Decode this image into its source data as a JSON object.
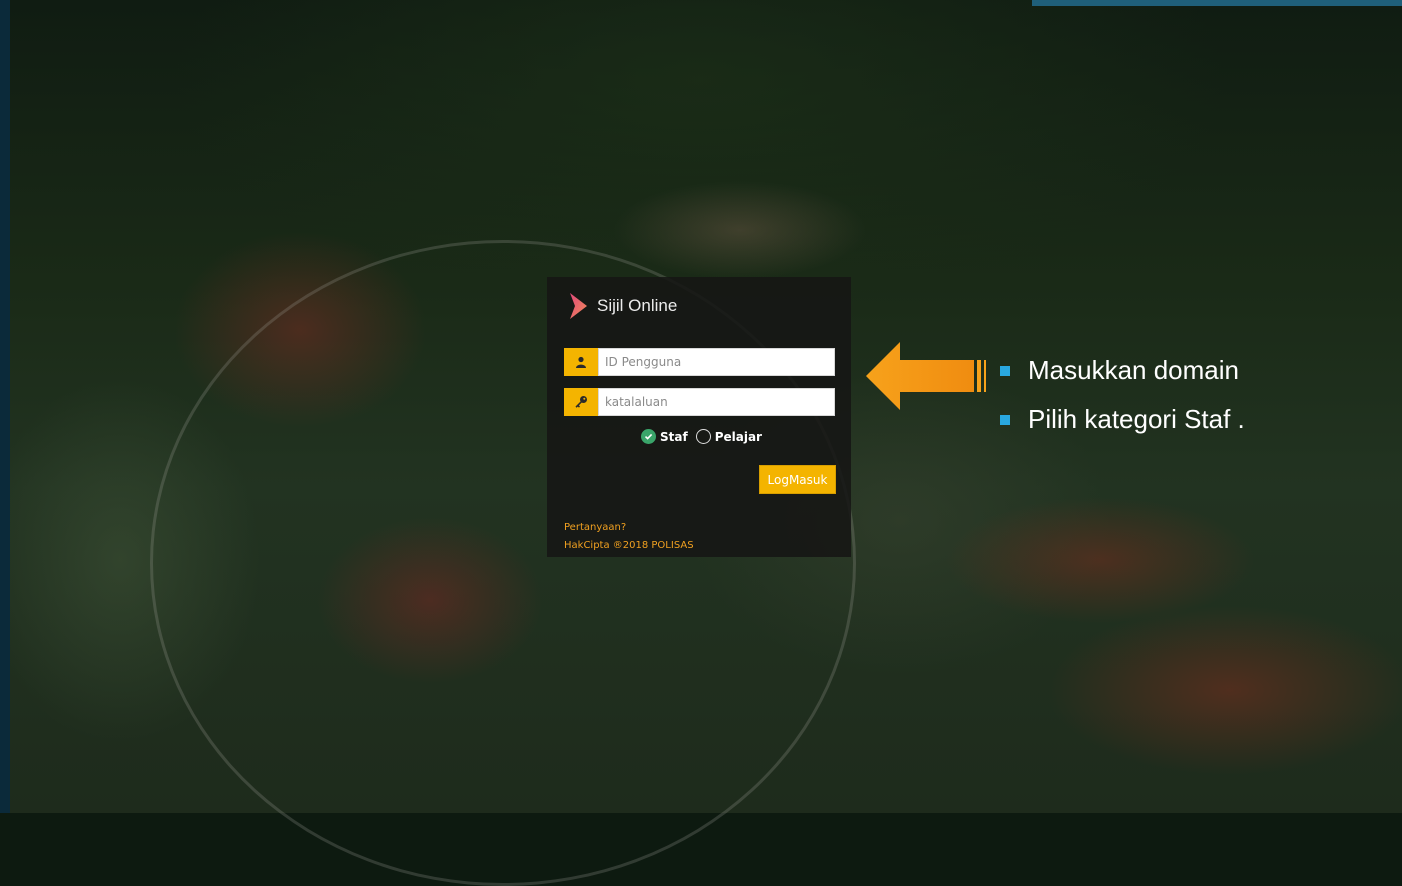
{
  "app": {
    "brand_name": "Sijil Online"
  },
  "login": {
    "username_placeholder": "ID Pengguna",
    "password_placeholder": "katalaluan",
    "category_options": [
      {
        "label": "Staf",
        "selected": true
      },
      {
        "label": "Pelajar",
        "selected": false
      }
    ],
    "submit_label": "LogMasuk",
    "help_link": "Pertanyaan?",
    "copyright": "HakCipta ®2018 POLISAS"
  },
  "annotations": {
    "notes": [
      "Masukkan domain",
      "Pilih kategori Staf ."
    ]
  },
  "colors": {
    "accent": "#f4b400",
    "bullet": "#29a8e0",
    "arrow": "#f7a21b",
    "link": "#f0a020"
  },
  "icons": {
    "brand": "chevron-logo-icon",
    "user": "user-icon",
    "password": "key-icon",
    "check": "check-circle-icon",
    "arrow": "left-arrow-icon"
  }
}
